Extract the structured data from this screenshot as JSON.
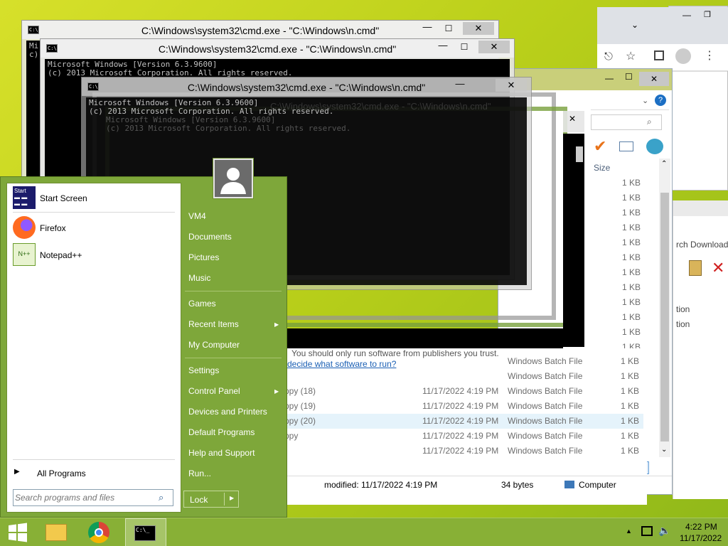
{
  "cmd": {
    "title": "C:\\Windows\\system32\\cmd.exe - \"C:\\Windows\\n.cmd\"",
    "line1": "Microsoft Windows [Version 6.3.9600]",
    "line2": "(c) 2013 Microsoft Corporation. All rights reserved.",
    "stub": "Mi\nc)"
  },
  "start_menu": {
    "pinned": [
      {
        "label": "Start Screen",
        "icon": "start-screen-icon"
      },
      {
        "label": "Firefox",
        "icon": "firefox-icon"
      },
      {
        "label": "Notepad++",
        "icon": "notepadpp-icon"
      }
    ],
    "all_programs": "All Programs",
    "search_placeholder": "Search programs and files",
    "right_links": {
      "user": "VM4",
      "documents": "Documents",
      "pictures": "Pictures",
      "music": "Music",
      "games": "Games",
      "recent_items": "Recent Items",
      "my_computer": "My Computer",
      "settings": "Settings",
      "control_panel": "Control Panel",
      "devices_printers": "Devices and Printers",
      "default_programs": "Default Programs",
      "help_support": "Help and Support",
      "run": "Run..."
    },
    "lock": "Lock"
  },
  "explorer": {
    "size_header": "Size",
    "sizes": [
      "1 KB",
      "1 KB",
      "1 KB",
      "1 KB",
      "1 KB",
      "1 KB",
      "1 KB",
      "1 KB",
      "1 KB",
      "1 KB",
      "1 KB",
      "1 KB"
    ],
    "search_downloads": "rch Downloads",
    "tion1": "tion",
    "tion2": "tion",
    "warning_text": "You should only run software from publishers you trust.",
    "warning_link": "decide what software to run?",
    "files": [
      {
        "name": "",
        "date": "",
        "type": "Windows Batch File",
        "size": "1 KB"
      },
      {
        "name": "",
        "date": "",
        "type": "Windows Batch File",
        "size": "1 KB"
      },
      {
        "name": "ppy (18)",
        "date": "11/17/2022 4:19 PM",
        "type": "Windows Batch File",
        "size": "1 KB"
      },
      {
        "name": "ppy (19)",
        "date": "11/17/2022 4:19 PM",
        "type": "Windows Batch File",
        "size": "1 KB"
      },
      {
        "name": "ppy (20)",
        "date": "11/17/2022 4:19 PM",
        "type": "Windows Batch File",
        "size": "1 KB"
      },
      {
        "name": "ppy",
        "date": "11/17/2022 4:19 PM",
        "type": "Windows Batch File",
        "size": "1 KB"
      },
      {
        "name": "",
        "date": "11/17/2022 4:19 PM",
        "type": "Windows Batch File",
        "size": "1 KB"
      }
    ],
    "status_modified": "modified: 11/17/2022 4:19 PM",
    "status_size": "34 bytes",
    "status_location": "Computer"
  },
  "taskbar": {
    "time": "4:22 PM",
    "date": "11/17/2022"
  },
  "colors": {
    "start_menu_bg": "#7ea73a",
    "taskbar_bg": "#88b036",
    "console_bg": "#000000"
  }
}
